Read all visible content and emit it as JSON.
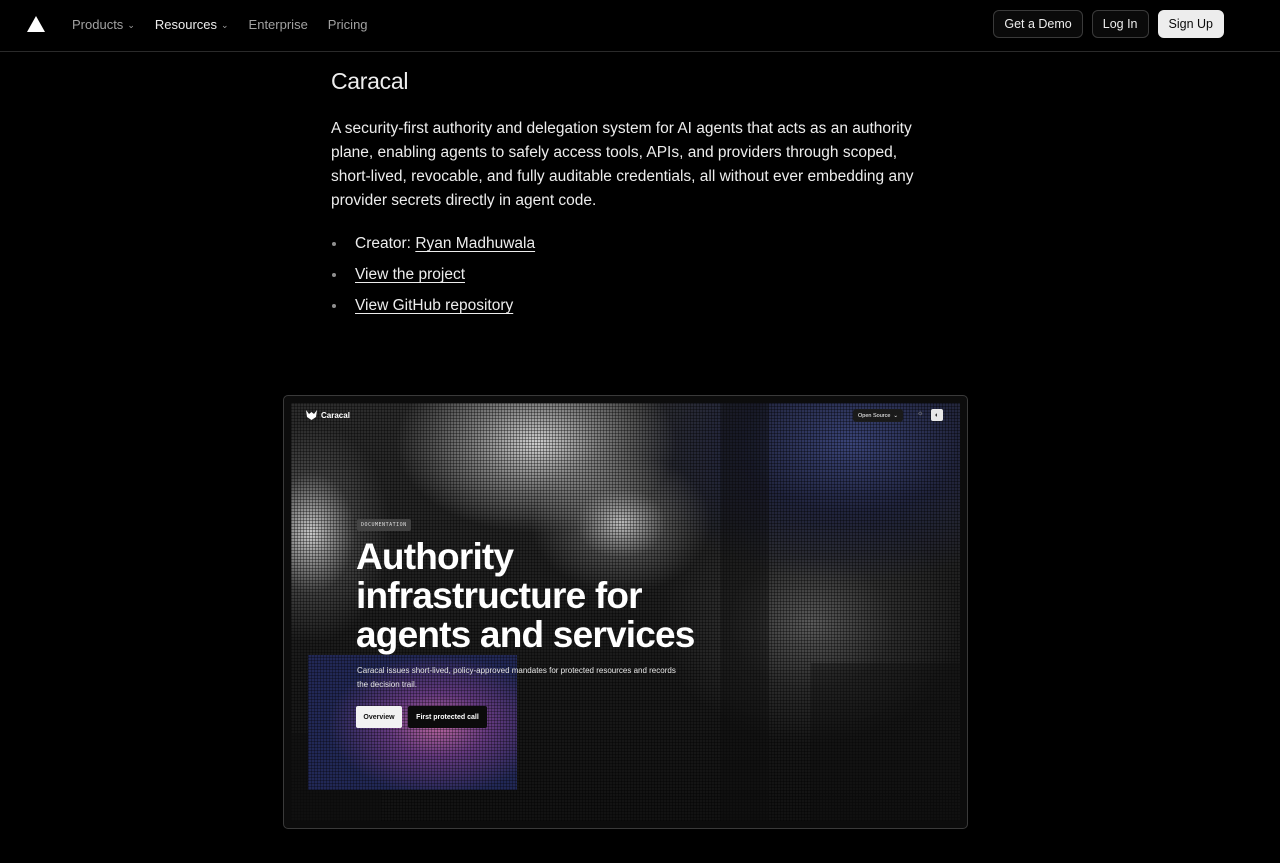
{
  "nav": {
    "items": [
      {
        "label": "Products",
        "has_menu": true
      },
      {
        "label": "Resources",
        "has_menu": true
      },
      {
        "label": "Enterprise",
        "has_menu": false
      },
      {
        "label": "Pricing",
        "has_menu": false
      }
    ],
    "demo_label": "Get a Demo",
    "login_label": "Log In",
    "signup_label": "Sign Up"
  },
  "article": {
    "title": "Caracal",
    "description": "A security-first authority and delegation system for AI agents that acts as an authority plane, enabling agents to safely access tools, APIs, and providers through scoped, short-lived, revocable, and fully auditable credentials, all without ever embedding any provider secrets directly in agent code.",
    "creator_prefix": "Creator: ",
    "creator_name": "Ryan Madhuwala",
    "project_link": "View the project",
    "repo_link": "View GitHub repository"
  },
  "preview": {
    "brand": "Caracal",
    "open_source_label": "Open Source",
    "tag": "DOCUMENTATION",
    "headline": "Authority infrastructure for agents and services",
    "subtitle": "Caracal issues short-lived, policy-approved mandates for protected resources and records the decision trail.",
    "primary_button": "Overview",
    "secondary_button": "First protected call"
  },
  "colors": {
    "background": "#000000",
    "text": "#ededed",
    "muted": "#a1a1a1",
    "border": "#2a2a2a"
  }
}
